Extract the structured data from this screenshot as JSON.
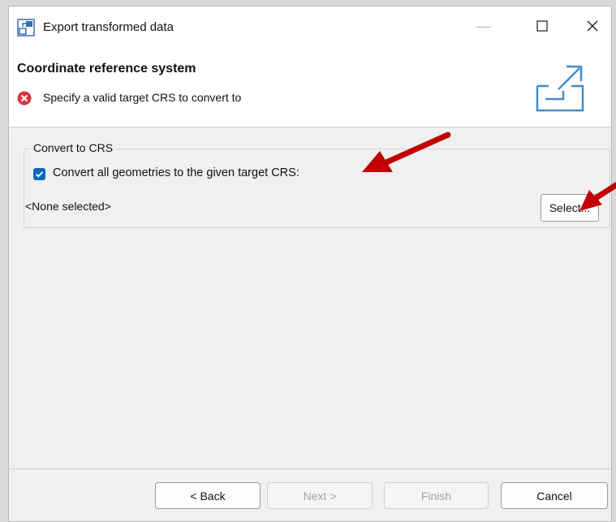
{
  "window": {
    "title": "Export transformed data",
    "min_glyph": "—",
    "max_glyph": "☐",
    "close_glyph": "✕"
  },
  "header": {
    "title": "Coordinate reference system",
    "message": "Specify a valid target CRS to convert to"
  },
  "group": {
    "legend": "Convert to CRS",
    "checkbox_label": "Convert all geometries to the given target CRS:",
    "checkbox_checked": true,
    "crs_value": "<None selected>",
    "select_label": "Select..."
  },
  "footer": {
    "back_label": "< Back",
    "next_label": "Next >",
    "finish_label": "Finish",
    "cancel_label": "Cancel"
  },
  "colors": {
    "accent": "#0a66c2",
    "error": "#d9363e",
    "annotation_arrow": "#c00000"
  }
}
